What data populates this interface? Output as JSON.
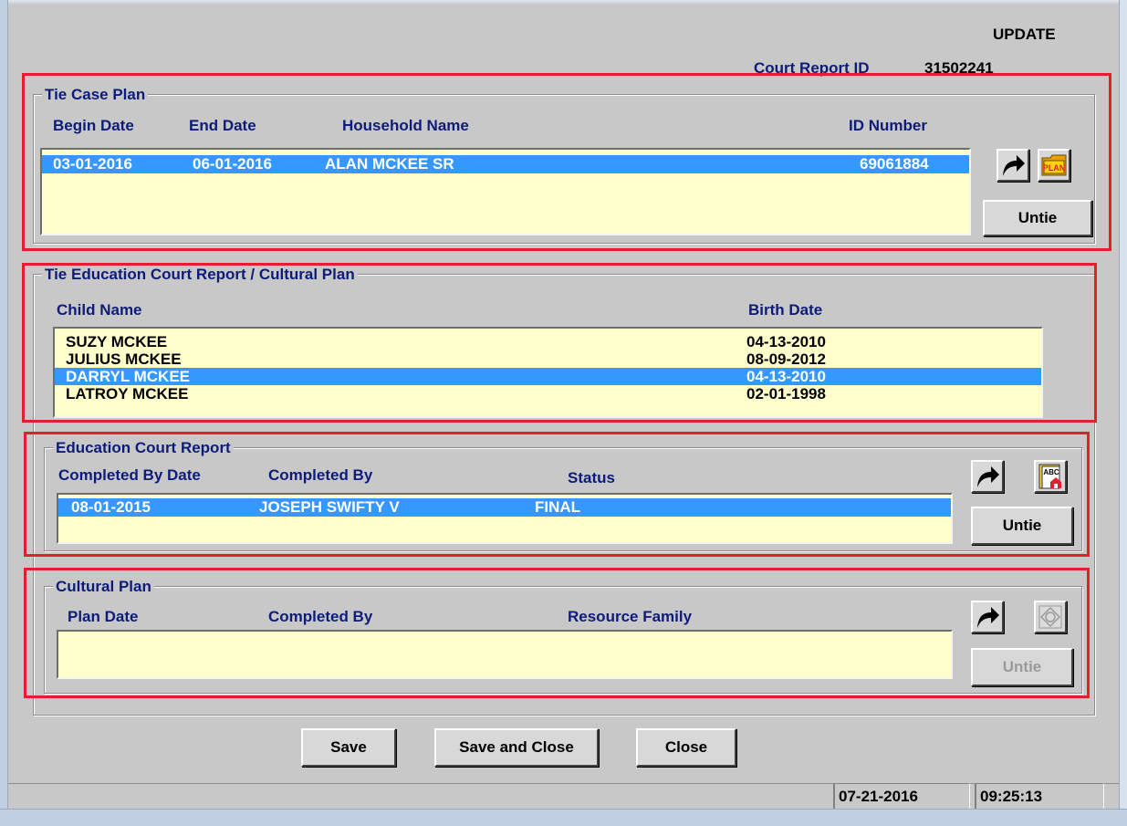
{
  "mode_label": "UPDATE",
  "court_report": {
    "label": "Court Report ID",
    "value": "31502241"
  },
  "tie_case_plan": {
    "title": "Tie Case Plan",
    "columns": [
      "Begin Date",
      "End Date",
      "Household Name",
      "ID Number"
    ],
    "rows": [
      {
        "begin": "03-01-2016",
        "end": "06-01-2016",
        "household": "ALAN MCKEE SR",
        "id": "69061884",
        "selected": true
      }
    ],
    "untie_label": "Untie",
    "icons": [
      "arrow-icon",
      "plan-icon"
    ]
  },
  "tie_education": {
    "title": "Tie Education Court Report / Cultural Plan",
    "columns": [
      "Child Name",
      "Birth Date"
    ],
    "rows": [
      {
        "name": "SUZY MCKEE",
        "birth": "04-13-2010",
        "selected": false
      },
      {
        "name": "JULIUS MCKEE",
        "birth": "08-09-2012",
        "selected": false
      },
      {
        "name": "DARRYL MCKEE",
        "birth": "04-13-2010",
        "selected": true
      },
      {
        "name": "LATROY MCKEE",
        "birth": "02-01-1998",
        "selected": false
      }
    ]
  },
  "education_court_report": {
    "title": "Education Court Report",
    "columns": [
      "Completed By Date",
      "Completed By",
      "Status"
    ],
    "rows": [
      {
        "date": "08-01-2015",
        "by": "JOSEPH SWIFTY V",
        "status": "FINAL",
        "selected": true
      }
    ],
    "untie_label": "Untie",
    "icons": [
      "arrow-icon",
      "abc-report-icon"
    ]
  },
  "cultural_plan": {
    "title": "Cultural Plan",
    "columns": [
      "Plan Date",
      "Completed By",
      "Resource Family"
    ],
    "rows": [],
    "untie_label": "Untie",
    "untie_enabled": false,
    "icons": [
      "arrow-icon",
      "cultural-plan-icon"
    ]
  },
  "buttons": {
    "save": "Save",
    "save_close": "Save and Close",
    "close": "Close"
  },
  "status": {
    "date": "07-21-2016",
    "time": "09:25:13"
  },
  "colors": {
    "navy": "#0d1c7a",
    "selection": "#3399ff",
    "list_bg": "#ffffcc",
    "highlight": "#e0202e"
  }
}
